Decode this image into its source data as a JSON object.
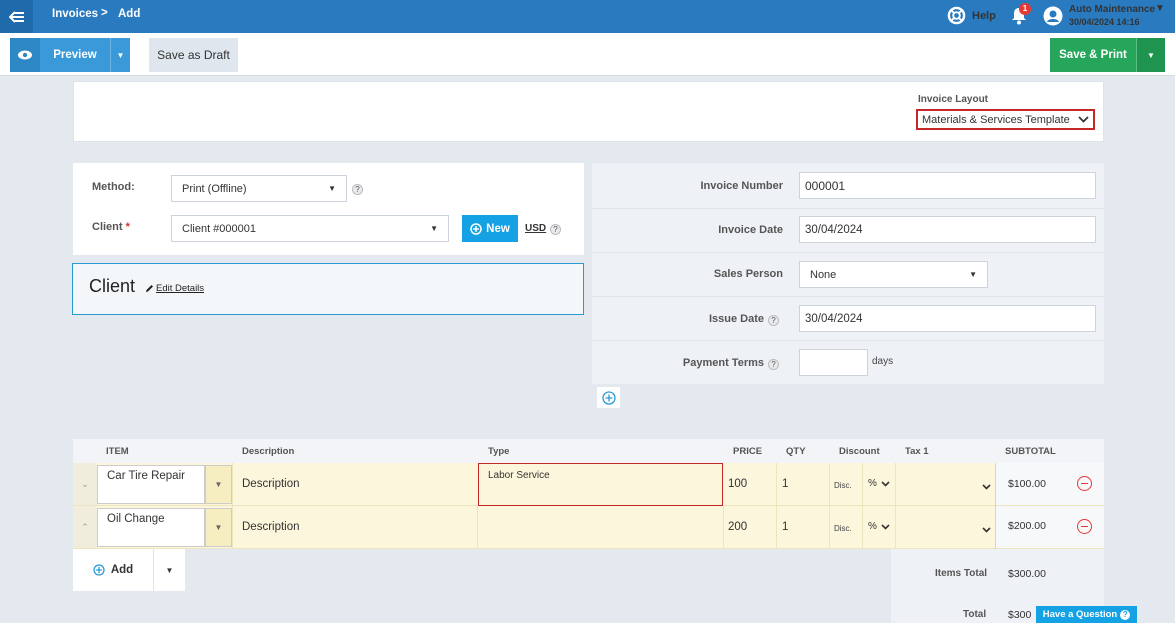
{
  "header": {
    "breadcrumb": [
      "Invoices",
      "Add"
    ],
    "separator": ">",
    "help_label": "Help",
    "notification_count": "1",
    "account_name": "Auto Maintenance",
    "account_datetime": "30/04/2024 14:16"
  },
  "toolbar": {
    "preview_label": "Preview",
    "draft_label": "Save as Draft",
    "save_print_label": "Save & Print"
  },
  "layout": {
    "label": "Invoice Layout",
    "selected": "Materials & Services Template"
  },
  "client_section": {
    "method_label": "Method:",
    "method_value": "Print (Offline)",
    "client_label": "Client",
    "required_mark": "*",
    "client_value": "Client #000001",
    "new_label": "New",
    "currency": "USD",
    "box_title": "Client",
    "edit_details": "Edit Details"
  },
  "invoice_fields": {
    "number_label": "Invoice Number",
    "number_value": "000001",
    "date_label": "Invoice Date",
    "date_value": "30/04/2024",
    "sales_label": "Sales Person",
    "sales_value": "None",
    "issue_label": "Issue Date",
    "issue_value": "30/04/2024",
    "terms_label": "Payment Terms",
    "terms_value": "",
    "terms_unit": "days"
  },
  "items_table": {
    "headers": {
      "item": "ITEM",
      "description": "Description",
      "type": "Type",
      "price": "PRICE",
      "qty": "QTY",
      "discount": "Discount",
      "tax": "Tax 1",
      "subtotal": "SUBTOTAL"
    },
    "rows": [
      {
        "item": "Car Tire Repair",
        "description": "Description",
        "type": "Labor Service",
        "price": "100",
        "qty": "1",
        "disc": "Disc.",
        "disc_type": "%",
        "tax": "",
        "subtotal": "$100.00"
      },
      {
        "item": "Oil Change",
        "description": "Description",
        "type": "",
        "price": "200",
        "qty": "1",
        "disc": "Disc.",
        "disc_type": "%",
        "tax": "",
        "subtotal": "$200.00"
      }
    ],
    "add_label": "Add"
  },
  "totals": {
    "items_total_label": "Items Total",
    "items_total_value": "$300.00",
    "total_label": "Total",
    "total_value": "$300"
  },
  "help_widget": {
    "label": "Have a Question"
  },
  "colors": {
    "header_blue": "#2a7ac0",
    "preview_blue": "#3a9ad9",
    "save_green": "#26a65b",
    "highlight_red": "#c62828",
    "row_yellow": "#fbf6dc"
  }
}
